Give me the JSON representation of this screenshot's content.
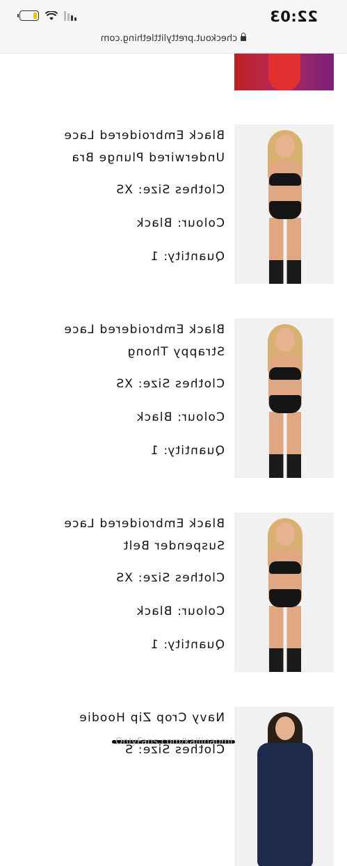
{
  "status_bar": {
    "time": "22:03",
    "url": "checkout.prettylittlething.com",
    "battery_level": 0.2,
    "battery_color": "#f2c300"
  },
  "items": [
    {
      "name": "Black Embroidered Lace Underwired Plunge Bra",
      "size_line": "Clothes Size: XS",
      "colour_line": "Colour: Black",
      "quantity_line": "Quantity: 1"
    },
    {
      "name": "Black Embroidered Lace Strappy Thong",
      "size_line": "Clothes Size: XS",
      "colour_line": "Colour: Black",
      "quantity_line": "Quantity: 1"
    },
    {
      "name": "Black Embroidered Lace Suspender Belt",
      "size_line": "Clothes Size: XS",
      "colour_line": "Colour: Black",
      "quantity_line": "Quantity: 1"
    },
    {
      "name": "Navy Crop Zip Hoodie",
      "size_line": "Clothes Size: S",
      "colour_line": "",
      "quantity_line": ""
    }
  ],
  "watermark": "OnlyFans.com/kailinaomi"
}
